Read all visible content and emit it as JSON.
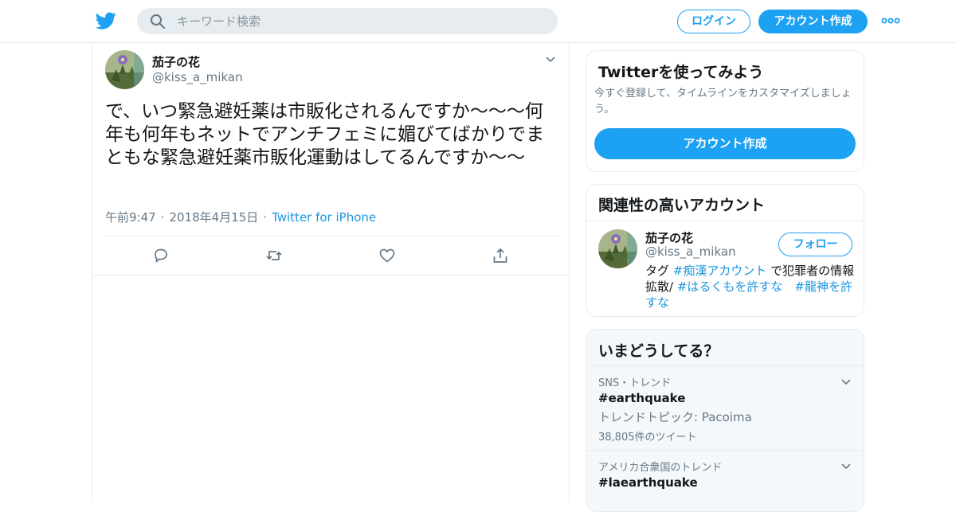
{
  "header": {
    "search_placeholder": "キーワード検索",
    "login_label": "ログイン",
    "signup_label": "アカウント作成"
  },
  "tweet": {
    "display_name": "茄子の花",
    "handle": "@kiss_a_mikan",
    "text": "で、いつ緊急避妊薬は市販化されるんですか〜〜〜何年も何年もネットでアンチフェミに媚びてばかりでまともな緊急避妊薬市販化運動はしてるんですか〜〜",
    "time": "午前9:47",
    "date": "2018年4月15日",
    "source": "Twitter for iPhone"
  },
  "signup_card": {
    "title": "Twitterを使ってみよう",
    "description": "今すぐ登録して、タイムラインをカスタマイズしましょう。",
    "button_label": "アカウント作成"
  },
  "related": {
    "title": "関連性の高いアカウント",
    "display_name": "茄子の花",
    "handle": "@kiss_a_mikan",
    "follow_label": "フォロー",
    "bio_prefix": "タグ ",
    "bio_tag1": "#痴漢アカウント",
    "bio_mid": " で犯罪者の情報拡散/ ",
    "bio_tag2": "#はるくもを許すな",
    "bio_tag3": "#龍神を許すな"
  },
  "trends": {
    "title": "いまどうしてる？",
    "items": [
      {
        "context": "SNS・トレンド",
        "name": "#earthquake",
        "topic": "トレンドトピック: Pacoima",
        "count": "38,805件のツイート"
      },
      {
        "context": "アメリカ合衆国のトレンド",
        "name": "#laearthquake"
      }
    ]
  },
  "colors": {
    "accent": "#1da1f2",
    "link": "#1b95e0",
    "secondary_text": "#657786",
    "border": "#e6ecf0"
  }
}
